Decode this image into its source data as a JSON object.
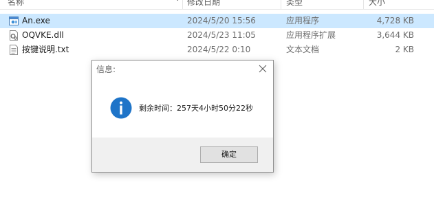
{
  "columns": {
    "name": "名称",
    "modified": "修改日期",
    "type": "类型",
    "size": "大小"
  },
  "files": [
    {
      "name": "An.exe",
      "modified": "2024/5/20 15:56",
      "type": "应用程序",
      "size": "4,728 KB",
      "icon": "exe-icon",
      "selected": true
    },
    {
      "name": "OQVKE.dll",
      "modified": "2024/5/23 11:05",
      "type": "应用程序扩展",
      "size": "3,644 KB",
      "icon": "dll-icon",
      "selected": false
    },
    {
      "name": "按键说明.txt",
      "modified": "2024/5/22 0:10",
      "type": "文本文档",
      "size": "2 KB",
      "icon": "txt-icon",
      "selected": false
    }
  ],
  "dialog": {
    "title": "信息:",
    "message": "剩余时间：257天4小时50分22秒",
    "ok_label": "确定",
    "icon": "info-icon"
  },
  "colors": {
    "selection": "#cce8ff",
    "info_icon": "#1e74c8",
    "dialog_footer": "#f0f0f0"
  }
}
